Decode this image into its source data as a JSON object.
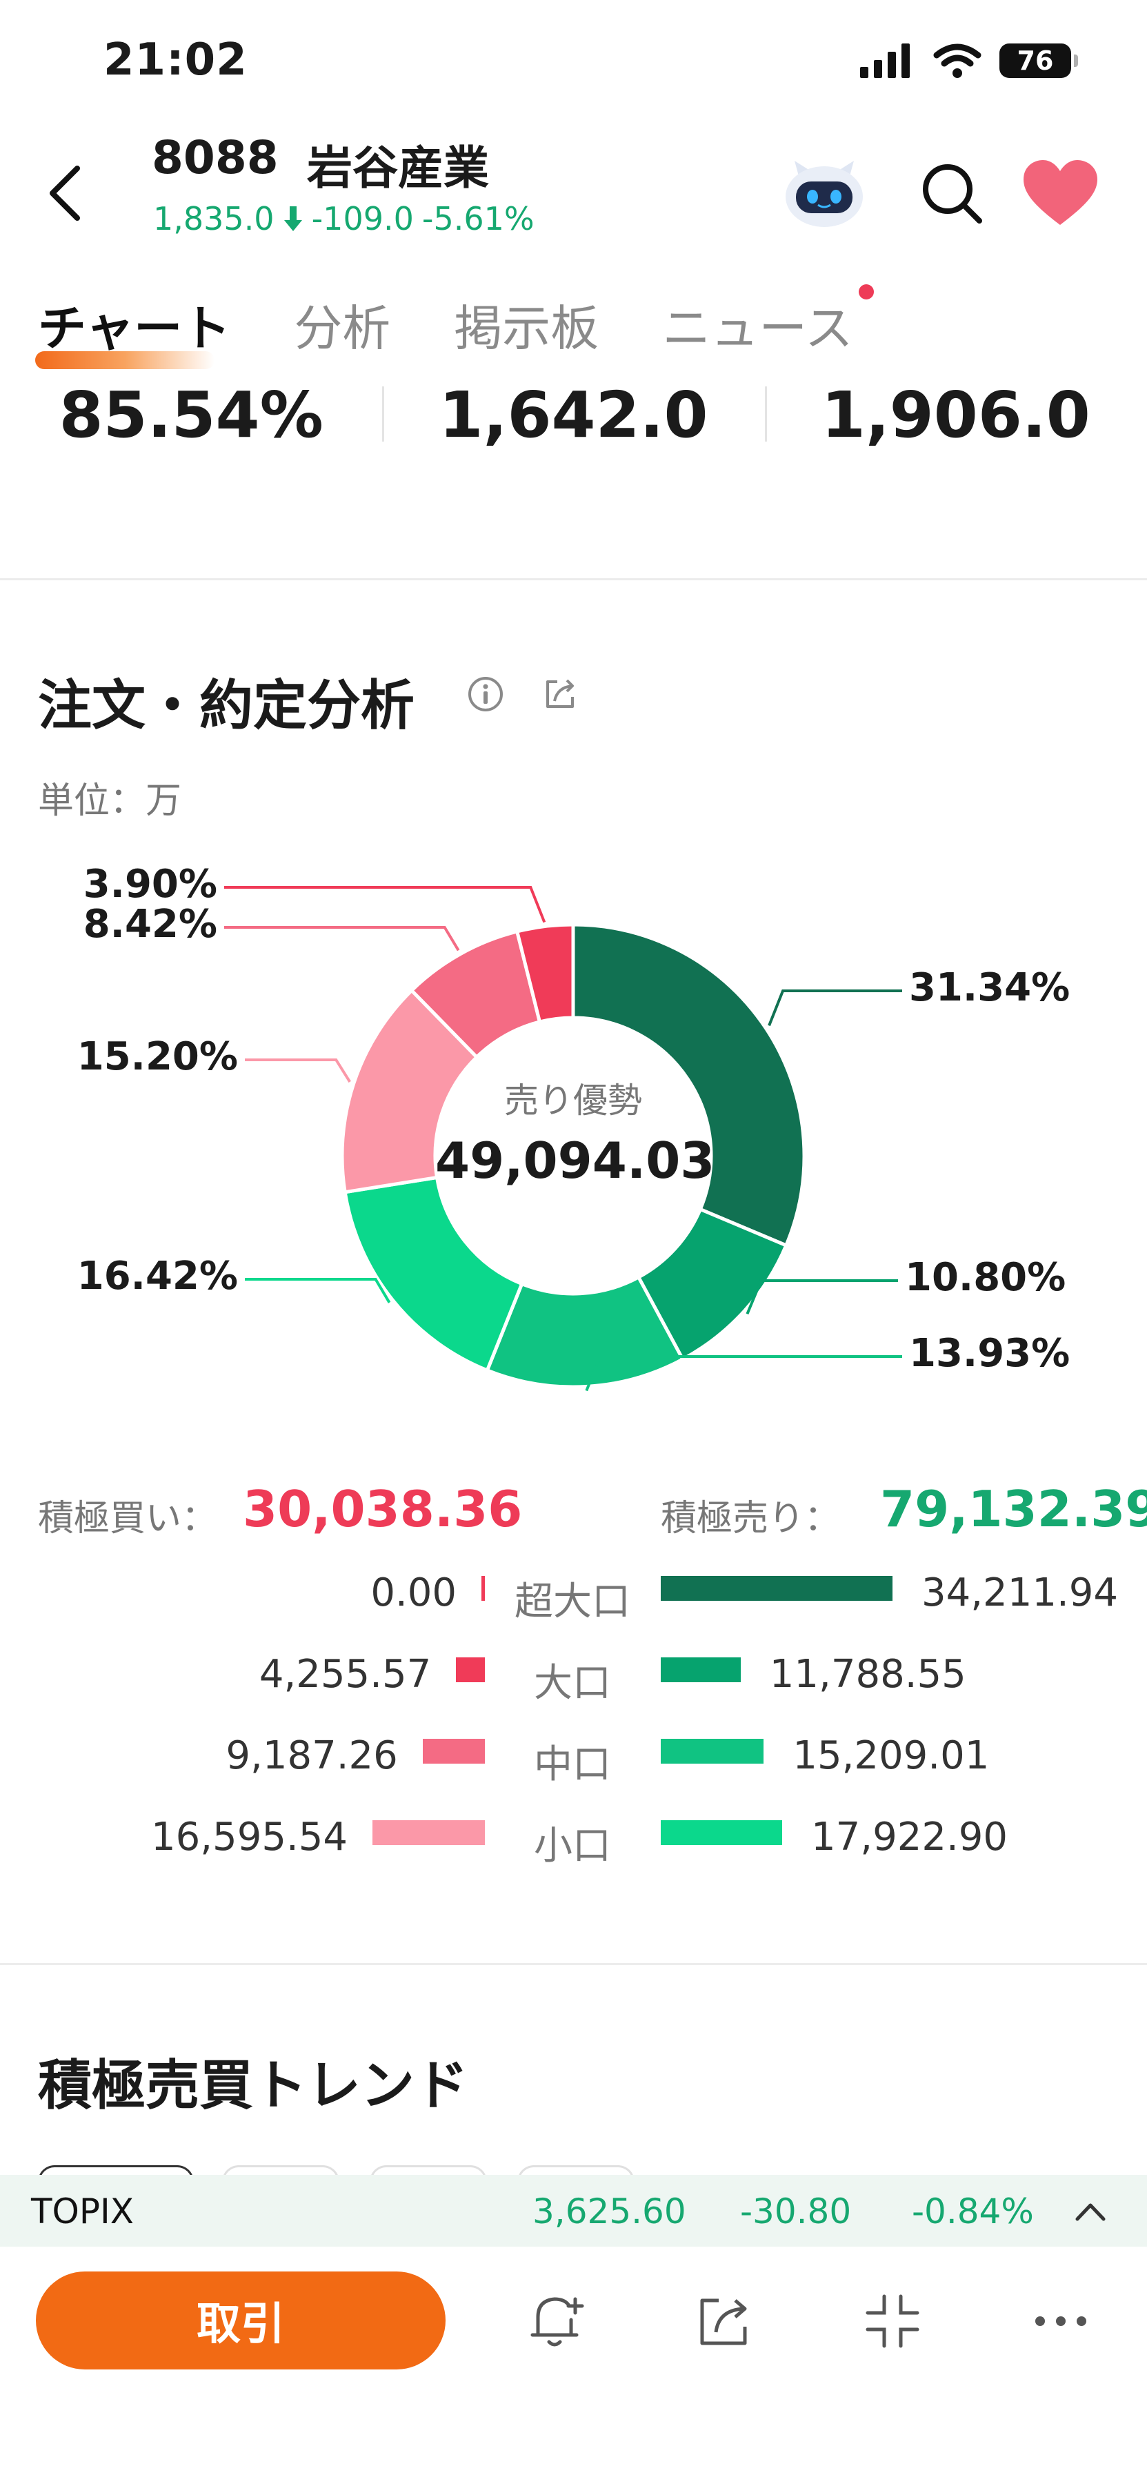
{
  "status": {
    "time": "21:02",
    "battery": "76"
  },
  "stock": {
    "code": "8088",
    "name": "岩谷産業",
    "price": "1,835.0",
    "change": "-109.0",
    "change_pct": "-5.61%"
  },
  "tabs": [
    {
      "label": "チャート",
      "active": true
    },
    {
      "label": "分析"
    },
    {
      "label": "掲示板"
    },
    {
      "label": "ニュース",
      "badge": true
    }
  ],
  "stats": [
    "85.54%",
    "1,642.0",
    "1,906.0"
  ],
  "order_analysis": {
    "title": "注文・約定分析",
    "unit": "単位：万",
    "center_label": "売り優勢",
    "center_value": "49,094.03",
    "buy_label": "積極買い：",
    "buy_total": "30,038.36",
    "sell_label": "積極売り：",
    "sell_total": "79,132.39",
    "breakdown": [
      {
        "category": "超大口",
        "buy": "0.00",
        "buy_value": 0.0,
        "sell": "34,211.94",
        "sell_value": 34211.94
      },
      {
        "category": "大口",
        "buy": "4,255.57",
        "buy_value": 4255.57,
        "sell": "11,788.55",
        "sell_value": 11788.55
      },
      {
        "category": "中口",
        "buy": "9,187.26",
        "buy_value": 9187.26,
        "sell": "15,209.01",
        "sell_value": 15209.01
      },
      {
        "category": "小口",
        "buy": "16,595.54",
        "buy_value": 16595.54,
        "sell": "17,922.90",
        "sell_value": 17922.9
      }
    ]
  },
  "chart_data": {
    "type": "pie",
    "donut": true,
    "categories": [
      "31.34%",
      "10.80%",
      "13.93%",
      "16.42%",
      "15.20%",
      "8.42%",
      "3.90%"
    ],
    "values": [
      31.34,
      10.8,
      13.93,
      16.42,
      15.2,
      8.42,
      3.9
    ],
    "colors": [
      "#117152",
      "#06a36e",
      "#10c382",
      "#0bd88c",
      "#fb98a8",
      "#f46b84",
      "#f03b58"
    ]
  },
  "colors": {
    "accent": "#f26a14",
    "up_red": "#ee3b57",
    "down_green": "#16a870",
    "sell_super": "#117152",
    "sell_large": "#06a36e",
    "sell_mid": "#10c382",
    "sell_small": "#0bd88c",
    "buy_super": "#f03b58",
    "buy_large": "#f03b58",
    "buy_mid": "#f46b84",
    "buy_small": "#fb98a8"
  },
  "trend": {
    "title": "積極売買トレンド"
  },
  "ticker": {
    "name": "TOPIX",
    "value": "3,625.60",
    "change": "-30.80",
    "change_pct": "-0.84%"
  },
  "bottom": {
    "trade_label": "取引"
  },
  "icons": [
    "back-icon",
    "robot-icon",
    "search-icon",
    "heart-icon",
    "info-icon",
    "share-icon",
    "bell-plus-icon",
    "share-out-icon",
    "collapse-icon",
    "more-icon"
  ]
}
